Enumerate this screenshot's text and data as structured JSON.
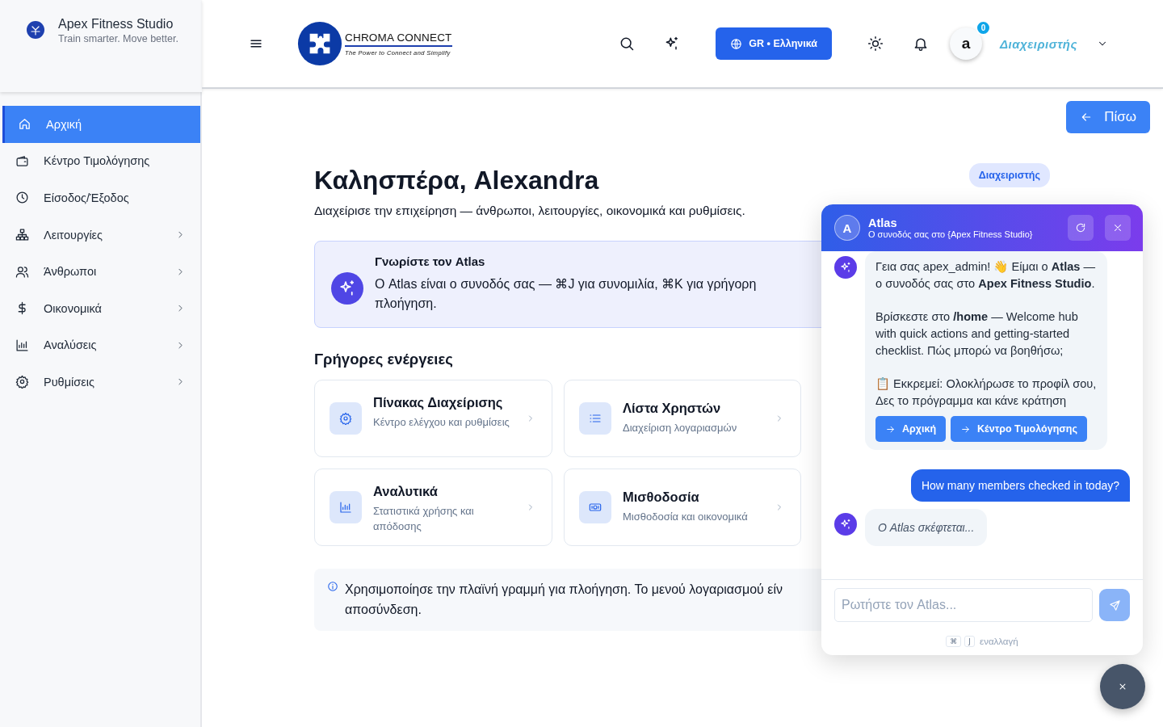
{
  "sidebar": {
    "brand": {
      "name": "Apex Fitness Studio",
      "tagline": "Train smarter. Move better."
    },
    "items": [
      {
        "label": "Αρχική",
        "kind": "home",
        "selected": true,
        "expandable": false
      },
      {
        "label": "Κέντρο Τιμολόγησης",
        "kind": "wallet",
        "selected": false,
        "expandable": false
      },
      {
        "label": "Είσοδος/Έξοδος",
        "kind": "clock",
        "selected": false,
        "expandable": false
      },
      {
        "label": "Λειτουργίες",
        "kind": "sitemap",
        "selected": false,
        "expandable": true
      },
      {
        "label": "Άνθρωποι",
        "kind": "people",
        "selected": false,
        "expandable": true
      },
      {
        "label": "Οικονομικά",
        "kind": "dollar",
        "selected": false,
        "expandable": true
      },
      {
        "label": "Αναλύσεις",
        "kind": "chart",
        "selected": false,
        "expandable": true
      },
      {
        "label": "Ρυθμίσεις",
        "kind": "gear",
        "selected": false,
        "expandable": true
      }
    ]
  },
  "topbar": {
    "logo": {
      "name": "CHROMA CONNECT",
      "tagline": "The Power to Connect and Simplify"
    },
    "language": "GR • Ελληνικά",
    "avatar": "a",
    "notifications": "0",
    "user_role": "Διαχειριστής"
  },
  "back_button": "Πίσω",
  "role_badge": "Διαχειριστής",
  "greeting": {
    "title": "Καλησπέρα, Alexandra",
    "subtitle": "Διαχείρισε την επιχείρηση — άνθρωποι, λειτουργίες, οικονομικά και ρυθμίσεις."
  },
  "atlas_intro": {
    "title": "Γνωρίστε τον Atlas",
    "text": "Ο Atlas είναι ο συνοδός σας — ⌘J για συνομιλία, ⌘K για γρήγορη πλοήγηση."
  },
  "quick_actions": {
    "title": "Γρήγορες ενέργειες",
    "items": [
      {
        "title": "Πίνακας Διαχείρισης",
        "subtitle": "Κέντρο ελέγχου και ρυθμίσεις",
        "kind": "gear"
      },
      {
        "title": "Λίστα Χρηστών",
        "subtitle": "Διαχείριση λογαριασμών",
        "kind": "list"
      },
      {
        "title": "Αναλυτικά",
        "subtitle": "Στατιστικά χρήσης και απόδοσης",
        "kind": "chart"
      },
      {
        "title": "Μισθοδοσία",
        "subtitle": "Μισθοδοσία και οικονομικά",
        "kind": "money"
      }
    ]
  },
  "info": {
    "lines": [
      "Χρησιμοποίησε την πλαϊνή γραμμή για πλοήγηση. Το μενού λογαριασμού είν",
      "αποσύνδεση."
    ]
  },
  "chat": {
    "avatar": "A",
    "title": "Atlas",
    "subtitle": "Ο συνοδός σας στο {Apex Fitness Studio}",
    "messages": [
      {
        "kind": "bot",
        "paragraphs": [
          "Γεια σας apex_admin! 👋 Είμαι ο **Atlas** — ο συνοδός σας στο **Apex Fitness Studio**.",
          "Βρίσκεστε στο **/home** — Welcome hub with quick actions and getting-started checklist. Πώς μπορώ να βοηθήσω;",
          "📋 Εκκρεμεί: Ολοκλήρωσε το προφίλ σου, Δες το πρόγραμμα και κάνε κράτηση"
        ],
        "actions": [
          "Αρχική",
          "Κέντρο Τιμολόγησης"
        ]
      },
      {
        "kind": "user",
        "text": "How many members checked in today?"
      },
      {
        "kind": "typing",
        "text": "Ο Atlas σκέφτεται..."
      }
    ],
    "input_placeholder": "Ρωτήστε τον Atlas...",
    "shortcut_keys": [
      "⌘",
      "J"
    ],
    "shortcut_label": "εναλλαγή"
  }
}
